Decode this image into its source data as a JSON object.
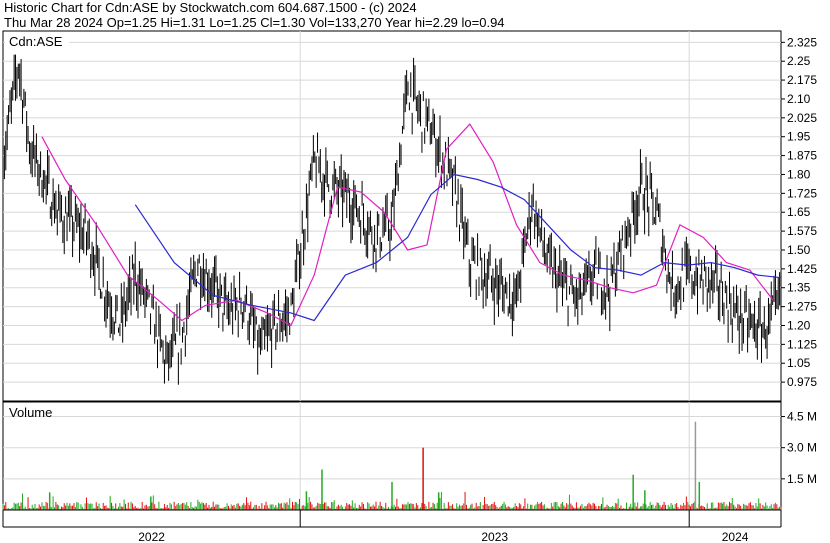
{
  "header": {
    "line1": "Historic Chart for Cdn:ASE by Stockwatch.com 604.687.1500 - (c) 2024",
    "line2": "Thu Mar 28 2024  Op=1.25  Hi=1.31  Lo=1.25  Cl=1.30  Vol=133,270  Year hi=2.29  lo=0.94"
  },
  "chart_data": [
    {
      "type": "line",
      "panel": "price",
      "label": "Cdn:ASE",
      "ylim": [
        0.9,
        2.37
      ],
      "y_ticks": [
        "2.325",
        "2.25",
        "2.175",
        "2.10",
        "2.025",
        "1.95",
        "1.875",
        "1.80",
        "1.725",
        "1.65",
        "1.575",
        "1.50",
        "1.425",
        "1.35",
        "1.275",
        "1.20",
        "1.125",
        "1.05",
        "0.975"
      ],
      "x_tick_labels": [
        "2022",
        "2023",
        "2024"
      ],
      "x_range": [
        0,
        1
      ],
      "x_dividers": [
        0.382,
        0.882
      ],
      "grid": true,
      "close_key": {
        "x": [
          0.0,
          0.02,
          0.035,
          0.05,
          0.07,
          0.09,
          0.11,
          0.13,
          0.15,
          0.17,
          0.19,
          0.21,
          0.23,
          0.25,
          0.27,
          0.29,
          0.31,
          0.33,
          0.35,
          0.37,
          0.385,
          0.4,
          0.42,
          0.44,
          0.46,
          0.48,
          0.5,
          0.52,
          0.535,
          0.55,
          0.56,
          0.58,
          0.6,
          0.62,
          0.64,
          0.66,
          0.68,
          0.7,
          0.72,
          0.74,
          0.76,
          0.78,
          0.8,
          0.82,
          0.84,
          0.86,
          0.88,
          0.9,
          0.92,
          0.94,
          0.96,
          0.98,
          1.0
        ],
        "y": [
          1.85,
          2.25,
          1.9,
          1.8,
          1.65,
          1.6,
          1.55,
          1.35,
          1.2,
          1.4,
          1.25,
          1.05,
          1.15,
          1.45,
          1.35,
          1.25,
          1.3,
          1.1,
          1.2,
          1.25,
          1.55,
          1.85,
          1.75,
          1.72,
          1.65,
          1.55,
          1.6,
          2.15,
          2.05,
          1.98,
          1.9,
          1.75,
          1.45,
          1.4,
          1.35,
          1.3,
          1.7,
          1.45,
          1.35,
          1.3,
          1.4,
          1.35,
          1.55,
          1.75,
          1.65,
          1.35,
          1.4,
          1.38,
          1.35,
          1.25,
          1.2,
          1.18,
          1.3
        ]
      },
      "series": [
        {
          "x": [
            0.05,
            0.08,
            0.12,
            0.16,
            0.2,
            0.23,
            0.26,
            0.3,
            0.34,
            0.37,
            0.4,
            0.43,
            0.46,
            0.49,
            0.52,
            0.545,
            0.57,
            0.6,
            0.63,
            0.66,
            0.69,
            0.72,
            0.75,
            0.78,
            0.81,
            0.84,
            0.87,
            0.9,
            0.93,
            0.96,
            0.99
          ],
          "y": [
            1.95,
            1.78,
            1.6,
            1.4,
            1.3,
            1.22,
            1.28,
            1.3,
            1.25,
            1.2,
            1.4,
            1.75,
            1.73,
            1.65,
            1.5,
            1.52,
            1.9,
            2.0,
            1.85,
            1.6,
            1.45,
            1.4,
            1.38,
            1.35,
            1.33,
            1.36,
            1.6,
            1.55,
            1.45,
            1.42,
            1.3
          ]
        },
        {
          "x": [
            0.17,
            0.22,
            0.27,
            0.32,
            0.37,
            0.4,
            0.44,
            0.48,
            0.52,
            0.55,
            0.58,
            0.61,
            0.64,
            0.67,
            0.7,
            0.73,
            0.76,
            0.79,
            0.82,
            0.85,
            0.88,
            0.91,
            0.94,
            0.97,
            1.0
          ],
          "y": [
            1.68,
            1.45,
            1.32,
            1.28,
            1.25,
            1.22,
            1.4,
            1.45,
            1.55,
            1.72,
            1.8,
            1.78,
            1.75,
            1.7,
            1.6,
            1.5,
            1.43,
            1.42,
            1.4,
            1.45,
            1.44,
            1.45,
            1.43,
            1.4,
            1.39
          ]
        }
      ]
    },
    {
      "type": "bar",
      "panel": "volume",
      "label": "Volume",
      "y_ticks": [
        "4.5 M",
        "3.0 M",
        "1.5 M"
      ],
      "ylim": [
        0,
        5.2
      ],
      "spikes": [
        {
          "x": 0.06,
          "value": 0.85,
          "dir": "up"
        },
        {
          "x": 0.19,
          "value": 0.65,
          "dir": "up"
        },
        {
          "x": 0.39,
          "value": 0.9,
          "dir": "up"
        },
        {
          "x": 0.41,
          "value": 1.95,
          "dir": "up"
        },
        {
          "x": 0.5,
          "value": 1.35,
          "dir": "up"
        },
        {
          "x": 0.54,
          "value": 3.0,
          "dir": "down"
        },
        {
          "x": 0.56,
          "value": 0.85,
          "dir": "up"
        },
        {
          "x": 0.81,
          "value": 1.7,
          "dir": "up"
        },
        {
          "x": 0.825,
          "value": 0.95,
          "dir": "up"
        },
        {
          "x": 0.89,
          "value": 4.25,
          "dir": "neutral"
        },
        {
          "x": 0.895,
          "value": 1.35,
          "dir": "up"
        }
      ]
    }
  ],
  "colors": {
    "price_up": "#000000",
    "ma_short": "#e020c0",
    "ma_long": "#2a2ad0",
    "vol_up": "#22aa22",
    "vol_down": "#dd1111",
    "vol_neutral": "#999999",
    "grid": "#d8d8d8",
    "axis": "#000000"
  }
}
